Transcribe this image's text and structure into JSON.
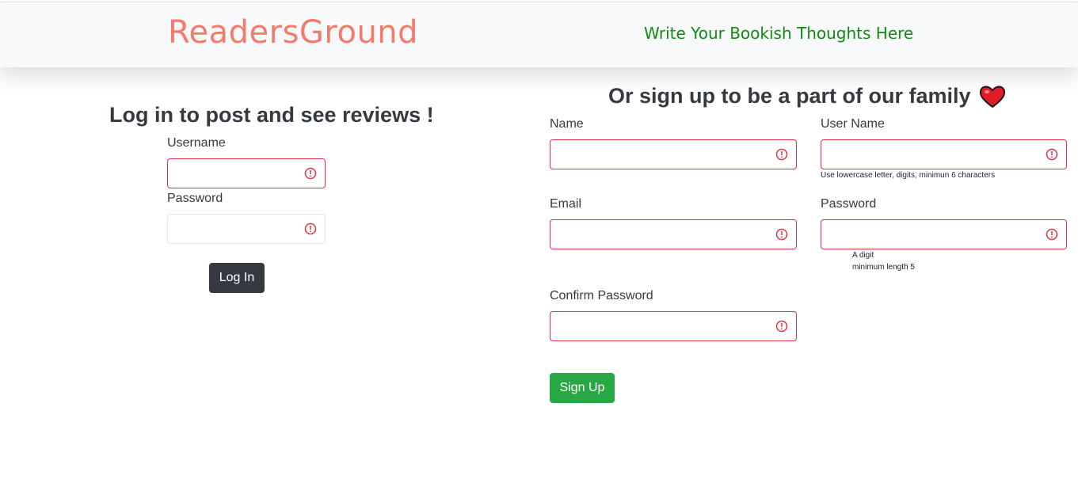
{
  "navbar": {
    "brand": "ReadersGround",
    "tagline": "Write Your Bookish Thoughts Here"
  },
  "login": {
    "title": "Log in to post and see reviews !",
    "username_label": "Username",
    "password_label": "Password",
    "button": "Log In"
  },
  "signup": {
    "title": "Or sign up to be a part of our family",
    "title_icon": "red-heart-emoji",
    "name_label": "Name",
    "username_label": "User Name",
    "username_hint": "Use lowercase letter, digits, minimun 6 characters",
    "email_label": "Email",
    "password_label": "Password",
    "password_hint_1": "A digit",
    "password_hint_2": "minimum length 5",
    "confirm_label": "Confirm Password",
    "button": "Sign Up"
  },
  "colors": {
    "brand": "#f27b6b",
    "tagline": "#118a11",
    "invalid": "#dc3545",
    "login_button": "#343a40",
    "signup_button": "#28a745"
  },
  "icons": {
    "field_status": "exclamation-circle-icon"
  }
}
